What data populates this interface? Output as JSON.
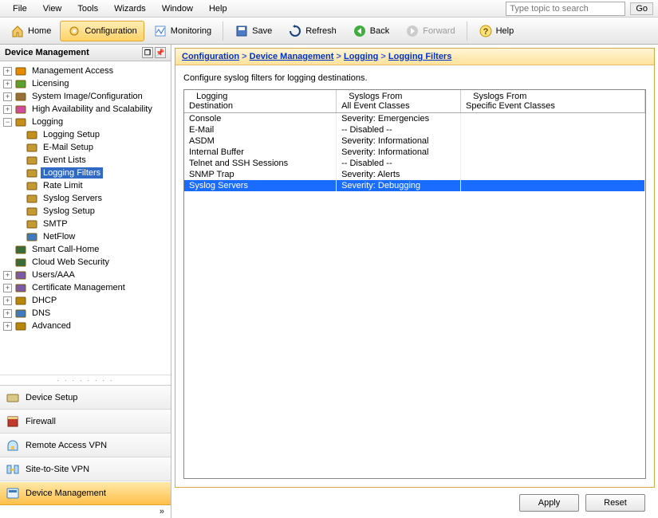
{
  "menu": {
    "items": [
      "File",
      "View",
      "Tools",
      "Wizards",
      "Window",
      "Help"
    ],
    "searchPlaceholder": "Type topic to search",
    "go": "Go"
  },
  "toolbar": {
    "home": "Home",
    "config": "Configuration",
    "monitoring": "Monitoring",
    "save": "Save",
    "refresh": "Refresh",
    "back": "Back",
    "forward": "Forward",
    "help": "Help"
  },
  "panel": {
    "title": "Device Management"
  },
  "tree": {
    "items": [
      {
        "label": "Management Access",
        "exp": "+",
        "ind": 0
      },
      {
        "label": "Licensing",
        "exp": "+",
        "ind": 0
      },
      {
        "label": "System Image/Configuration",
        "exp": "+",
        "ind": 0
      },
      {
        "label": "High Availability and Scalability",
        "exp": "+",
        "ind": 0
      },
      {
        "label": "Logging",
        "exp": "−",
        "ind": 0
      },
      {
        "label": "Logging Setup",
        "exp": "",
        "ind": 1
      },
      {
        "label": "E-Mail Setup",
        "exp": "",
        "ind": 1
      },
      {
        "label": "Event Lists",
        "exp": "",
        "ind": 1
      },
      {
        "label": "Logging Filters",
        "exp": "",
        "ind": 1,
        "sel": true
      },
      {
        "label": "Rate Limit",
        "exp": "",
        "ind": 1
      },
      {
        "label": "Syslog Servers",
        "exp": "",
        "ind": 1
      },
      {
        "label": "Syslog Setup",
        "exp": "",
        "ind": 1
      },
      {
        "label": "SMTP",
        "exp": "",
        "ind": 1
      },
      {
        "label": "NetFlow",
        "exp": "",
        "ind": 1
      },
      {
        "label": "Smart Call-Home",
        "exp": "",
        "ind": 0
      },
      {
        "label": "Cloud Web Security",
        "exp": "",
        "ind": 0
      },
      {
        "label": "Users/AAA",
        "exp": "+",
        "ind": 0
      },
      {
        "label": "Certificate Management",
        "exp": "+",
        "ind": 0
      },
      {
        "label": "DHCP",
        "exp": "+",
        "ind": 0
      },
      {
        "label": "DNS",
        "exp": "+",
        "ind": 0
      },
      {
        "label": "Advanced",
        "exp": "+",
        "ind": 0
      }
    ]
  },
  "nav": {
    "items": [
      {
        "label": "Device Setup"
      },
      {
        "label": "Firewall"
      },
      {
        "label": "Remote Access VPN"
      },
      {
        "label": "Site-to-Site VPN"
      },
      {
        "label": "Device Management",
        "active": true
      }
    ]
  },
  "breadcrumb": {
    "parts": [
      "Configuration",
      "Device Management",
      "Logging",
      "Logging Filters"
    ]
  },
  "content": {
    "desc": "Configure syslog filters for logging destinations.",
    "columns": [
      "Logging\nDestination",
      "Syslogs From\nAll Event Classes",
      "Syslogs From\nSpecific Event Classes"
    ],
    "rows": [
      {
        "c": [
          "Console",
          "Severity: Emergencies",
          ""
        ]
      },
      {
        "c": [
          "E-Mail",
          "-- Disabled --",
          ""
        ]
      },
      {
        "c": [
          "ASDM",
          "Severity: Informational",
          ""
        ]
      },
      {
        "c": [
          "Internal Buffer",
          "Severity: Informational",
          ""
        ]
      },
      {
        "c": [
          "Telnet and SSH Sessions",
          "-- Disabled --",
          ""
        ]
      },
      {
        "c": [
          "SNMP Trap",
          "Severity: Alerts",
          ""
        ]
      },
      {
        "c": [
          "Syslog Servers",
          "Severity: Debugging",
          ""
        ],
        "sel": true
      }
    ]
  },
  "buttons": {
    "apply": "Apply",
    "reset": "Reset"
  }
}
